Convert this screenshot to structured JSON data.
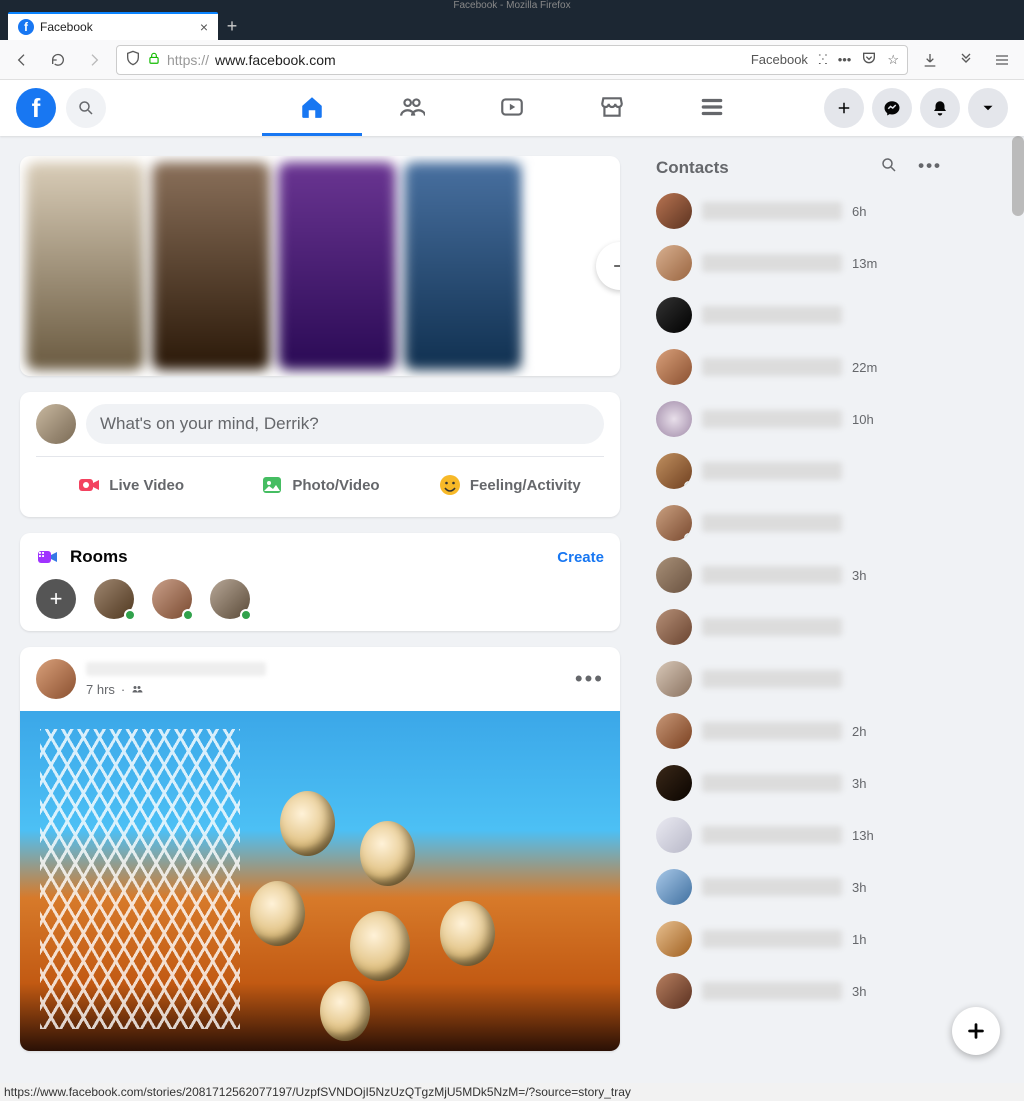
{
  "browser": {
    "window_title": "Facebook - Mozilla Firefox",
    "tab_title": "Facebook",
    "url_protocol": "https://",
    "url_host": "www.facebook.com",
    "identity_label": "Facebook",
    "status_url": "https://www.facebook.com/stories/2081712562077197/UzpfSVNDOjI5NzUzQTgzMjU5MDk5NzM=/?source=story_tray"
  },
  "composer": {
    "placeholder": "What's on your mind, Derrik?",
    "live_label": "Live Video",
    "photo_label": "Photo/Video",
    "feeling_label": "Feeling/Activity"
  },
  "rooms": {
    "title": "Rooms",
    "create_label": "Create"
  },
  "post": {
    "time": "7 hrs"
  },
  "rail": {
    "title": "Contacts"
  },
  "contacts": [
    {
      "time": "6h",
      "online": false,
      "bg": "linear-gradient(135deg,#b87452,#5c3320)"
    },
    {
      "time": "13m",
      "online": false,
      "bg": "linear-gradient(135deg,#d8b090,#9a6540)"
    },
    {
      "time": "",
      "online": false,
      "bg": "linear-gradient(135deg,#333,#000)"
    },
    {
      "time": "22m",
      "online": false,
      "bg": "linear-gradient(135deg,#d9a07a,#8a5030)"
    },
    {
      "time": "10h",
      "online": false,
      "bg": "radial-gradient(circle,#e8dfea,#a08aa8)"
    },
    {
      "time": "",
      "online": true,
      "bg": "linear-gradient(135deg,#c09060,#704020)"
    },
    {
      "time": "",
      "online": true,
      "bg": "linear-gradient(135deg,#caa080,#7a4a30)"
    },
    {
      "time": "3h",
      "online": false,
      "bg": "linear-gradient(135deg,#a89078,#6a5240)"
    },
    {
      "time": "",
      "online": false,
      "bg": "linear-gradient(135deg,#b69078,#6a4430)"
    },
    {
      "time": "",
      "online": false,
      "bg": "linear-gradient(135deg,#d8c8b8,#8a7260)"
    },
    {
      "time": "2h",
      "online": false,
      "bg": "linear-gradient(135deg,#c89878,#7a4020)"
    },
    {
      "time": "3h",
      "online": false,
      "bg": "linear-gradient(135deg,#3a2818,#0a0400)"
    },
    {
      "time": "13h",
      "online": false,
      "bg": "linear-gradient(135deg,#eaeaf2,#b8b8c8)"
    },
    {
      "time": "3h",
      "online": false,
      "bg": "linear-gradient(135deg,#a8c8e8,#4070a0)"
    },
    {
      "time": "1h",
      "online": false,
      "bg": "linear-gradient(135deg,#e8c090,#a06020)"
    },
    {
      "time": "3h",
      "online": false,
      "bg": "linear-gradient(135deg,#b88060,#5a3020)"
    }
  ]
}
